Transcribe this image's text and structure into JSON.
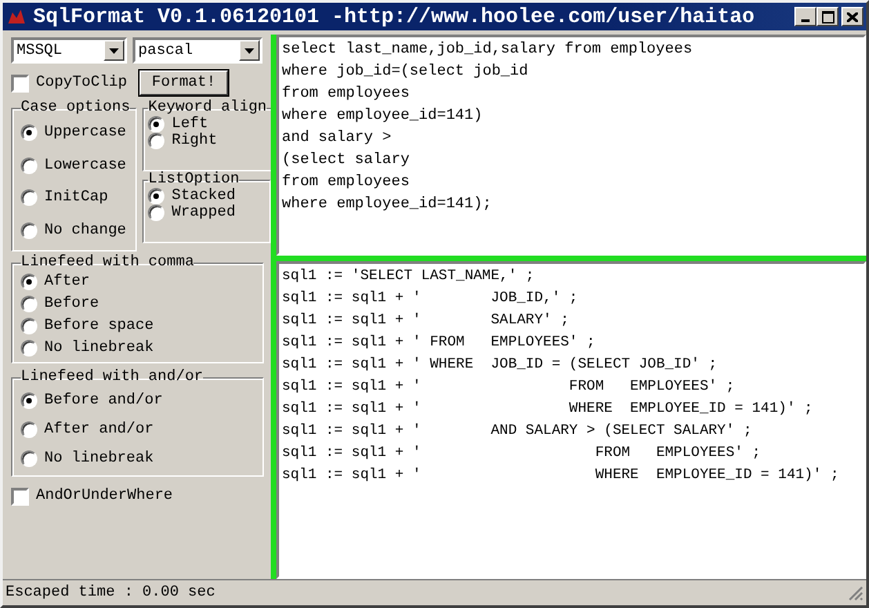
{
  "window": {
    "title": "SqlFormat V0.1.06120101 -http://www.hoolee.com/user/haitao"
  },
  "database_select": {
    "value": "MSSQL"
  },
  "language_select": {
    "value": "pascal"
  },
  "copy_to_clip": {
    "label": "CopyToClip",
    "checked": false
  },
  "format_button": {
    "label": "Format!"
  },
  "case_options": {
    "title": "Case options",
    "options": [
      {
        "label": "Uppercase",
        "selected": true
      },
      {
        "label": "Lowercase",
        "selected": false
      },
      {
        "label": "InitCap",
        "selected": false
      },
      {
        "label": "No change",
        "selected": false
      }
    ]
  },
  "keyword_align": {
    "title": "Keyword align",
    "options": [
      {
        "label": "Left",
        "selected": true
      },
      {
        "label": "Right",
        "selected": false
      }
    ]
  },
  "list_option": {
    "title": "ListOption",
    "options": [
      {
        "label": "Stacked",
        "selected": true
      },
      {
        "label": "Wrapped",
        "selected": false
      }
    ]
  },
  "linefeed_with_comma": {
    "title": "Linefeed with comma",
    "options": [
      {
        "label": "After",
        "selected": true
      },
      {
        "label": "Before",
        "selected": false
      },
      {
        "label": "Before space",
        "selected": false
      },
      {
        "label": "No linebreak",
        "selected": false
      }
    ]
  },
  "linefeed_with_and_or": {
    "title": "Linefeed with and/or",
    "options": [
      {
        "label": "Before and/or",
        "selected": true
      },
      {
        "label": "After and/or",
        "selected": false
      },
      {
        "label": "No linebreak",
        "selected": false
      }
    ]
  },
  "and_or_under_where": {
    "label": "AndOrUnderWhere",
    "checked": false
  },
  "input_editor": {
    "lines": [
      "select last_name,job_id,salary from employees",
      "where job_id=(select job_id",
      "from employees",
      "where employee_id=141)",
      "and salary >",
      "(select salary",
      "from employees",
      "where employee_id=141);"
    ]
  },
  "output_editor": {
    "lines": [
      "sql1 := 'SELECT LAST_NAME,' ;",
      "sql1 := sql1 + '        JOB_ID,' ;",
      "sql1 := sql1 + '        SALARY' ;",
      "sql1 := sql1 + ' FROM   EMPLOYEES' ;",
      "sql1 := sql1 + ' WHERE  JOB_ID = (SELECT JOB_ID' ;",
      "sql1 := sql1 + '                 FROM   EMPLOYEES' ;",
      "sql1 := sql1 + '                 WHERE  EMPLOYEE_ID = 141)' ;",
      "sql1 := sql1 + '        AND SALARY > (SELECT SALARY' ;",
      "sql1 := sql1 + '                    FROM   EMPLOYEES' ;",
      "sql1 := sql1 + '                    WHERE  EMPLOYEE_ID = 141)' ;"
    ]
  },
  "status_bar": {
    "text": "Escaped time : 0.00 sec"
  }
}
